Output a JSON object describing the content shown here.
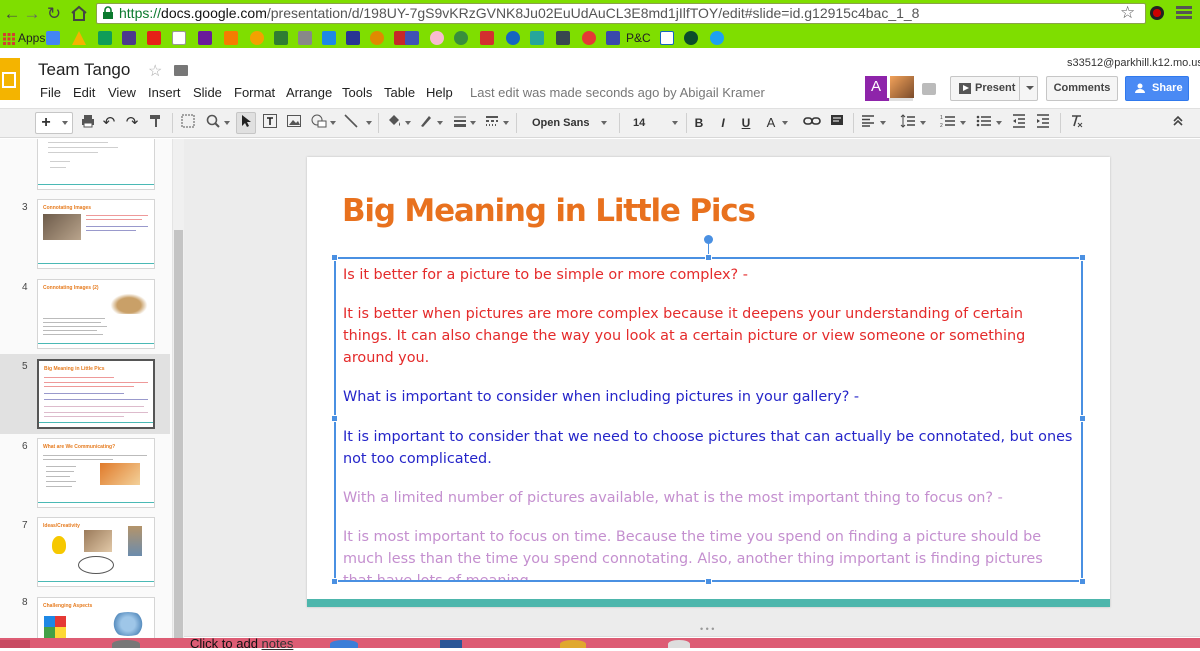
{
  "browser": {
    "url_scheme": "https://",
    "url_host": "docs.google.com",
    "url_path": "/presentation/d/198UY-7gS9vKRzGVNK8Ju02EuUdAuCL3E8md1jIlfTOY/edit#slide=id.g12915c4bac_1_8",
    "bookmarks_label": "Apps",
    "bookmark_pc_label": "P&C",
    "colors": {
      "chrome": "#7fde00",
      "taskbar": "#dd5c74"
    }
  },
  "docs": {
    "title": "Team Tango",
    "menus": [
      "File",
      "Edit",
      "View",
      "Insert",
      "Slide",
      "Format",
      "Arrange",
      "Tools",
      "Table",
      "Help"
    ],
    "last_edit": "Last edit was made seconds ago by Abigail Kramer",
    "user_email": "s33512@parkhill.k12.mo.us",
    "avatar_letter": "A",
    "present_label": "Present",
    "comments_label": "Comments",
    "share_label": "Share"
  },
  "toolbar": {
    "font": "Open Sans",
    "font_size": "14",
    "bold": "B",
    "italic": "I",
    "underline": "U",
    "text_color": "A"
  },
  "filmstrip": {
    "slides": [
      {
        "number": "3",
        "title": "Connotating Images"
      },
      {
        "number": "4",
        "title": "Connotating Images (2)"
      },
      {
        "number": "5",
        "title": "Big Meaning in Little Pics",
        "selected": true
      },
      {
        "number": "6",
        "title": "What are We Communicating?"
      },
      {
        "number": "7",
        "title": "Ideas/Creativity"
      },
      {
        "number": "8",
        "title": "Challenging Aspects"
      }
    ]
  },
  "slide": {
    "title": "Big Meaning in Little Pics",
    "paragraphs": [
      {
        "color": "red",
        "text": "Is it better for a picture to be simple or more complex? -"
      },
      {
        "color": "red",
        "text": "It is better when pictures are more complex because it deepens your understanding of certain things. It can also change the way you look at a certain picture or view someone or something around you."
      },
      {
        "color": "blue",
        "text": "What is important to consider when including pictures in your gallery? -"
      },
      {
        "color": "blue",
        "text": "It is important to consider that we need to choose pictures that can actually be connotated, but ones not too complicated."
      },
      {
        "color": "lilac",
        "text": "With a limited number of pictures available, what is the most important thing to focus on? -"
      },
      {
        "color": "lilac",
        "text": "It is most important to focus on time. Because the time you spend on finding a picture should be much less than the time you spend connotating. Also, another thing important is finding pictures that have lots of meaning."
      }
    ],
    "colors": {
      "title": "#e8711e",
      "red": "#e42b2b",
      "blue": "#2525c9",
      "lilac": "#c48fcf",
      "footer": "#4db6ac"
    }
  },
  "notes": {
    "label_prefix": "Click to add",
    "label_link": "notes"
  }
}
